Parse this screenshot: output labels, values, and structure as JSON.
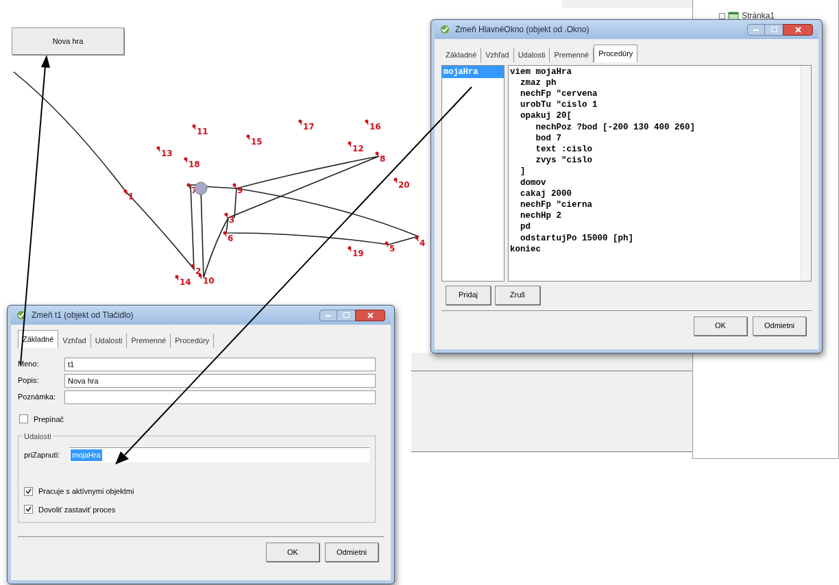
{
  "canvas": {
    "button": "Nova hra",
    "points": [
      "1",
      "2",
      "3",
      "4",
      "5",
      "6",
      "7",
      "8",
      "9",
      "10",
      "11",
      "12",
      "13",
      "14",
      "15",
      "16",
      "17",
      "18",
      "19",
      "20"
    ]
  },
  "tree": {
    "items": [
      {
        "label": "Stránka1"
      }
    ]
  },
  "procedures_dialog": {
    "title": "Zmeň HlavnéOkno (objekt od .Okno)",
    "tabs": [
      {
        "label": "Základné",
        "selected": false
      },
      {
        "label": "Vzhľad",
        "selected": false
      },
      {
        "label": "Udalosti",
        "selected": false
      },
      {
        "label": "Premenné",
        "selected": false
      },
      {
        "label": "Procedúry",
        "selected": true
      }
    ],
    "procedures": [
      {
        "name": "mojaHra",
        "selected": true
      }
    ],
    "code": [
      "viem mojaHra",
      "  zmaz ph",
      "  nechFp \"cervena",
      "  urobTu \"cislo 1",
      "  opakuj 20[",
      "     nechPoz ?bod [-200 130 400 260]",
      "     bod 7",
      "     text :cislo",
      "     zvys \"cislo",
      "  ]",
      "  domov",
      "  cakaj 2000",
      "  nechFp \"cierna",
      "  nechHp 2",
      "  pd",
      "  odstartujPo 15000 [ph]",
      "koniec"
    ],
    "buttons": [
      "Pridaj",
      "Zruš"
    ],
    "footer_buttons": [
      "OK",
      "Odmietni"
    ]
  },
  "button_dialog": {
    "title": "Zmeň t1 (objekt od Tlačidlo)",
    "tabs": [
      {
        "label": "Základné",
        "selected": true
      },
      {
        "label": "Vzhľad",
        "selected": false
      },
      {
        "label": "Udalosti",
        "selected": false
      },
      {
        "label": "Premenné",
        "selected": false
      },
      {
        "label": "Procedúry",
        "selected": false
      }
    ],
    "fields": [
      {
        "label": "Meno:",
        "value": "t1"
      },
      {
        "label": "Popis:",
        "value": "Nova hra"
      },
      {
        "label": "Poznámka:"
      }
    ],
    "toggle": {
      "label": "Prepínač",
      "checked": false
    },
    "events": {
      "title": "Udalosti",
      "label": "priZapnutí:",
      "value": "mojaHra",
      "value_selected": true
    },
    "options": [
      {
        "label": "Pracuje s aktívnymi objektmi",
        "checked": true
      },
      {
        "label": "Dovoliť zastaviť proces",
        "checked": true
      }
    ],
    "footer_buttons": [
      "OK",
      "Odmietni"
    ]
  }
}
